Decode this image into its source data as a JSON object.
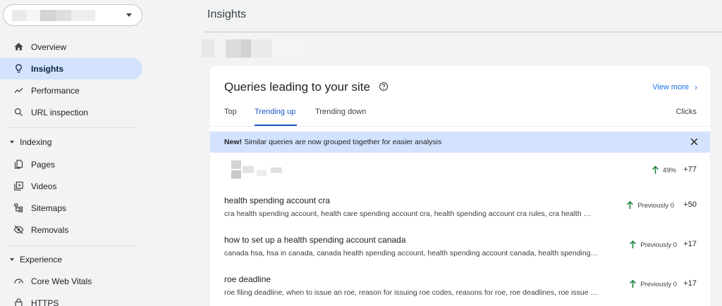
{
  "sidebar": {
    "property_select": {
      "value": ""
    },
    "top_items": [
      {
        "label": "Overview",
        "icon": "home-icon"
      },
      {
        "label": "Insights",
        "icon": "lightbulb-icon",
        "active": true
      },
      {
        "label": "Performance",
        "icon": "trending-up-icon"
      },
      {
        "label": "URL inspection",
        "icon": "search-icon"
      }
    ],
    "sections": [
      {
        "title": "Indexing",
        "items": [
          {
            "label": "Pages",
            "icon": "pages-icon"
          },
          {
            "label": "Videos",
            "icon": "video-icon"
          },
          {
            "label": "Sitemaps",
            "icon": "sitemap-icon"
          },
          {
            "label": "Removals",
            "icon": "eye-off-icon"
          }
        ]
      },
      {
        "title": "Experience",
        "items": [
          {
            "label": "Core Web Vitals",
            "icon": "gauge-icon"
          },
          {
            "label": "HTTPS",
            "icon": "lock-icon"
          }
        ]
      }
    ]
  },
  "header": {
    "title": "Insights"
  },
  "card": {
    "title": "Queries leading to your site",
    "view_more": "View more",
    "tabs": [
      "Top",
      "Trending up",
      "Trending down"
    ],
    "active_tab": "Trending up",
    "column_label": "Clicks",
    "banner": {
      "bold": "New!",
      "text": "Similar queries are now grouped together for easier analysis"
    },
    "rows": [
      {
        "query": "",
        "related": "",
        "trend": "49%",
        "clicks": "+77"
      },
      {
        "query": "health spending account cra",
        "related": "cra health spending account, health care spending account cra, health spending account cra rules, cra health …",
        "trend": "Previously 0",
        "clicks": "+50"
      },
      {
        "query": "how to set up a health spending account canada",
        "related": "canada hsa, hsa in canada, canada health spending account, health spending account canada, health spending…",
        "trend": "Previously 0",
        "clicks": "+17"
      },
      {
        "query": "roe deadline",
        "related": "roe filing deadline, when to issue an roe, reason for issuing roe codes, reasons for roe, roe deadlines, roe issue …",
        "trend": "Previously 0",
        "clicks": "+17"
      }
    ]
  },
  "colors": {
    "accent": "#1a73e8",
    "active_nav": "#d3e3fd",
    "trend_up": "#188038"
  }
}
